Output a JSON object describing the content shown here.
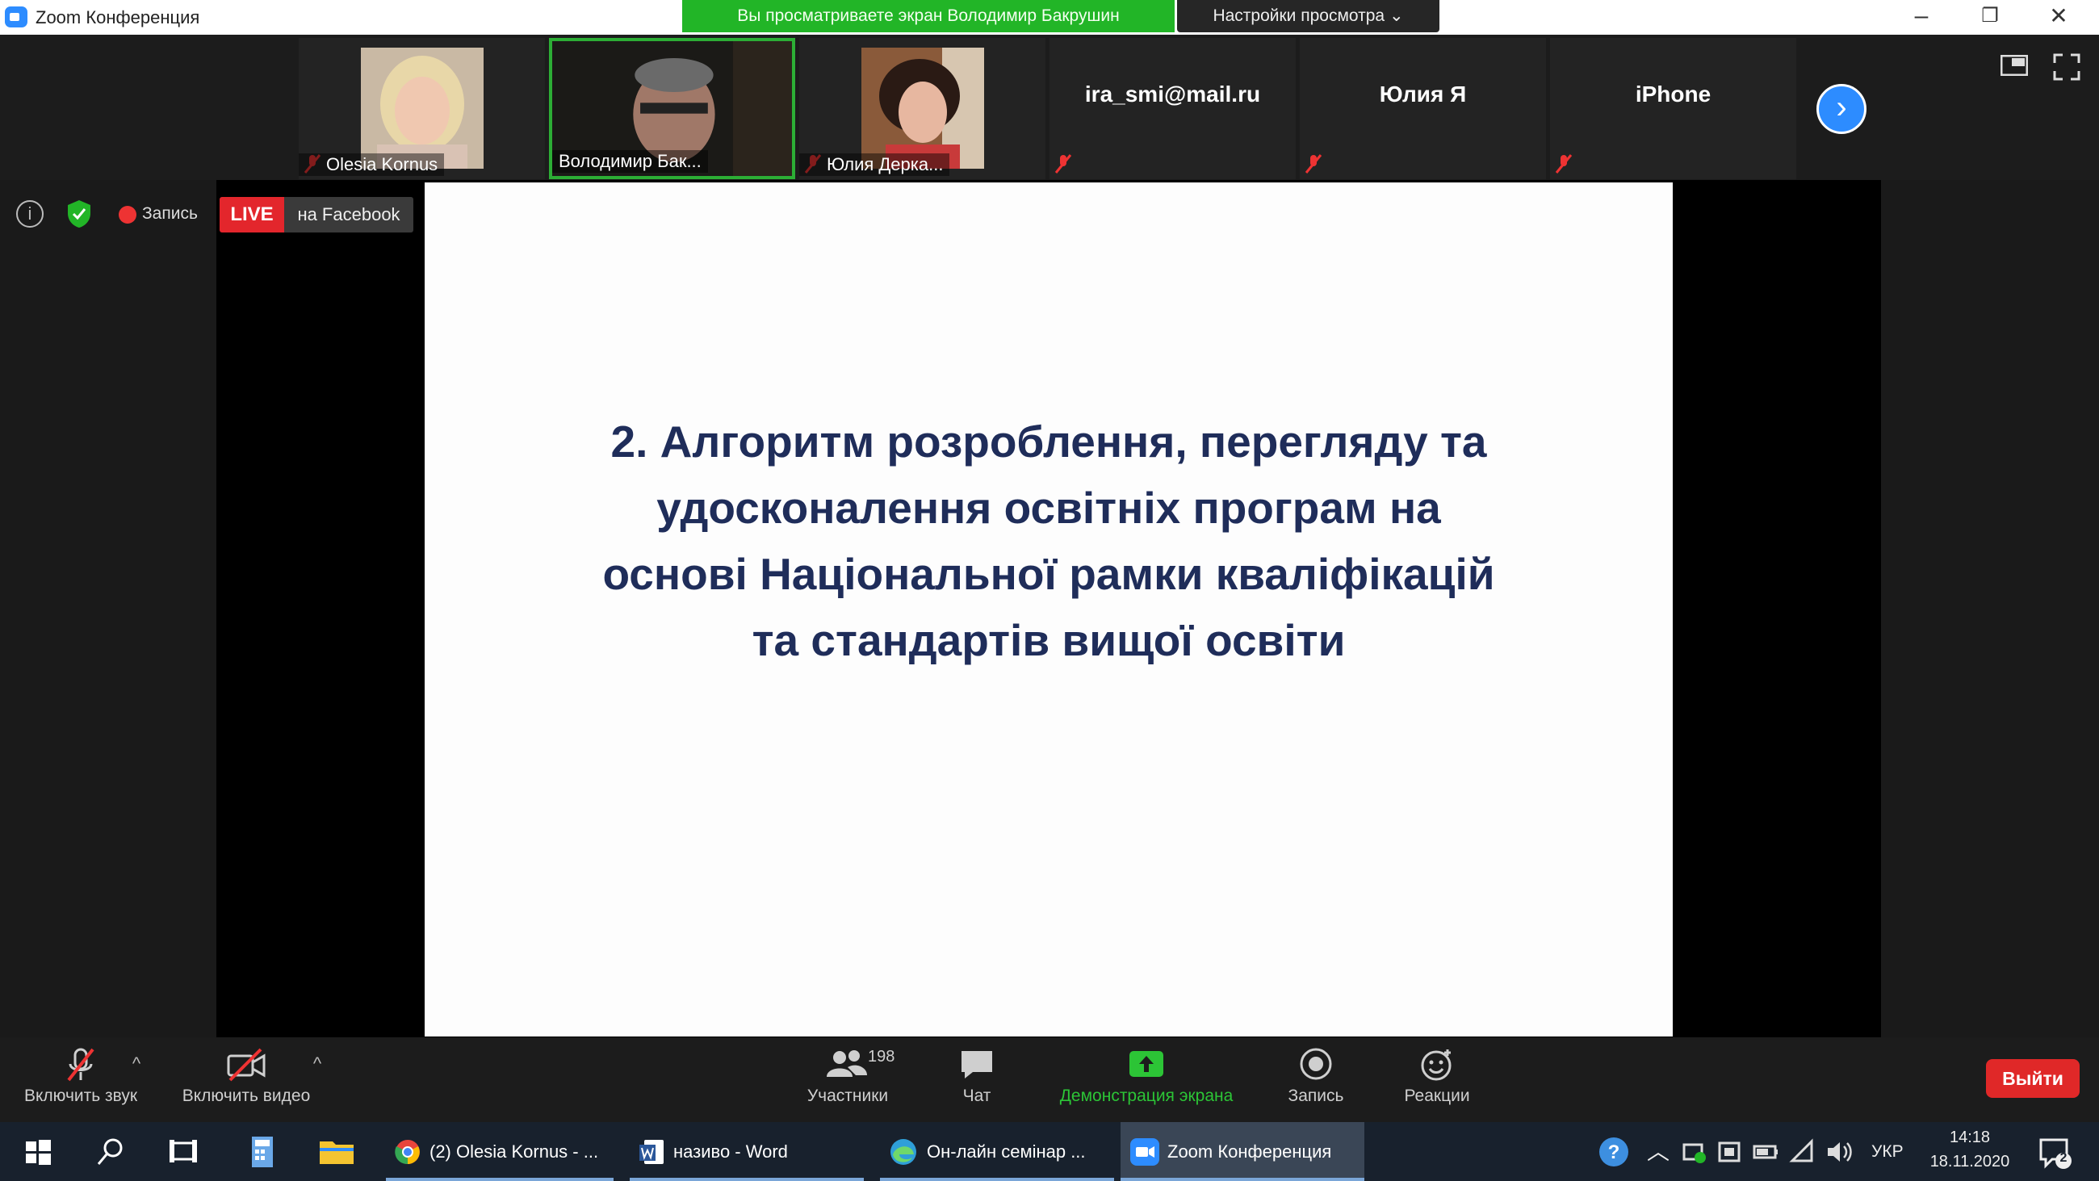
{
  "window": {
    "title": "Zoom Конференция",
    "share_banner": "Вы просматриваете экран Володимир Бакрушин",
    "view_options": "Настройки просмотра ⌄",
    "minimize": "–",
    "restore": "❐",
    "close": "✕"
  },
  "participants": [
    {
      "name": "Olesia Kornus",
      "has_video": true,
      "muted": true
    },
    {
      "name": "Володимир Бак...",
      "has_video": true,
      "muted": false,
      "active_speaker": true
    },
    {
      "name": "Юлия Дерка...",
      "has_video": true,
      "muted": true
    },
    {
      "name": "ira_smi@mail.ru",
      "has_video": false,
      "muted": true
    },
    {
      "name": "Юлия Я",
      "has_video": false,
      "muted": true
    },
    {
      "name": "iPhone",
      "has_video": false,
      "muted": true
    }
  ],
  "status": {
    "info": "i",
    "recording_label": "Запись",
    "live_label": "LIVE",
    "live_target": "на Facebook"
  },
  "slide": {
    "lines": [
      "2. Алгоритм розроблення, перегляду та",
      "удосконалення освітніх програм на",
      "основі Національної рамки кваліфікацій",
      "та стандартів вищої освіти"
    ]
  },
  "toolbar": {
    "unmute": "Включить звук",
    "start_video": "Включить видео",
    "participants": "Участники",
    "participants_count": "198",
    "chat": "Чат",
    "share_screen": "Демонстрация экрана",
    "record": "Запись",
    "reactions": "Реакции",
    "leave": "Выйти",
    "caret": "^"
  },
  "taskbar": {
    "tasks": [
      {
        "label": "(2) Olesia Kornus - ...",
        "icon": "chrome-icon"
      },
      {
        "label": "називо - Word",
        "icon": "word-icon"
      },
      {
        "label": "Он-лайн семінар ...",
        "icon": "edge-icon"
      },
      {
        "label": "Zoom Конференция",
        "icon": "zoom-icon"
      }
    ],
    "language": "УКР",
    "time": "14:18",
    "date": "18.11.2020",
    "notification_count": "2"
  },
  "colors": {
    "share_banner": "#22b527",
    "live_badge": "#e3262c",
    "leave_button": "#e02828",
    "slide_text": "#1f2d5a",
    "accent": "#2d8cff"
  }
}
